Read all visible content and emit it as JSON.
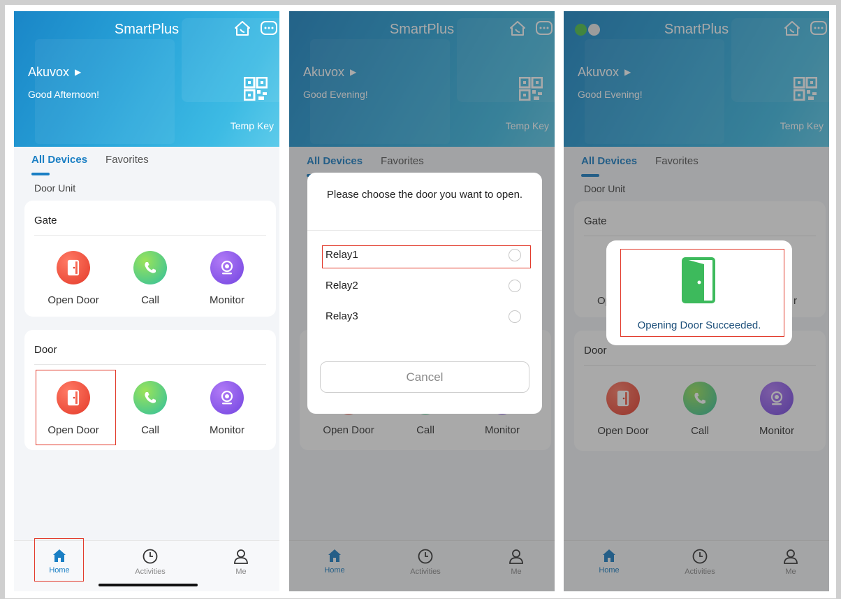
{
  "colors": {
    "accent": "#1a7fc4",
    "highlight_box": "#e23b2c",
    "open_door": "#e43a2a",
    "call": "#2fbf9e",
    "monitor": "#7244e0"
  },
  "screens": [
    {
      "app_title": "SmartPlus",
      "user_name": "Akuvox",
      "greeting": "Good Afternoon!",
      "temp_key": "Temp Key",
      "tabs": [
        "All Devices",
        "Favorites"
      ],
      "section": "Door Unit",
      "cards": [
        {
          "title": "Gate",
          "actions": [
            "Open Door",
            "Call",
            "Monitor"
          ]
        },
        {
          "title": "Door",
          "actions": [
            "Open Door",
            "Call",
            "Monitor"
          ]
        }
      ],
      "nav": [
        "Home",
        "Activities",
        "Me"
      ]
    },
    {
      "app_title": "SmartPlus",
      "user_name": "Akuvox",
      "greeting": "Good Evening!",
      "temp_key": "Temp Key",
      "tabs": [
        "All Devices",
        "Favorites"
      ],
      "actions": [
        "Open Door",
        "Call",
        "Monitor"
      ],
      "nav": [
        "Home",
        "Activities",
        "Me"
      ],
      "dialog": {
        "title": "Please choose the door you want to open.",
        "options": [
          "Relay1",
          "Relay2",
          "Relay3"
        ],
        "cancel": "Cancel"
      }
    },
    {
      "app_title": "SmartPlus",
      "user_name": "Akuvox",
      "greeting": "Good Evening!",
      "temp_key": "Temp Key",
      "tabs": [
        "All Devices",
        "Favorites"
      ],
      "section": "Door Unit",
      "cards": [
        {
          "title": "Gate",
          "actions": [
            "Op",
            "r"
          ]
        },
        {
          "title": "Door",
          "actions": [
            "Open Door",
            "Call",
            "Monitor"
          ]
        }
      ],
      "nav": [
        "Home",
        "Activities",
        "Me"
      ],
      "toast": "Opening Door Succeeded."
    }
  ]
}
